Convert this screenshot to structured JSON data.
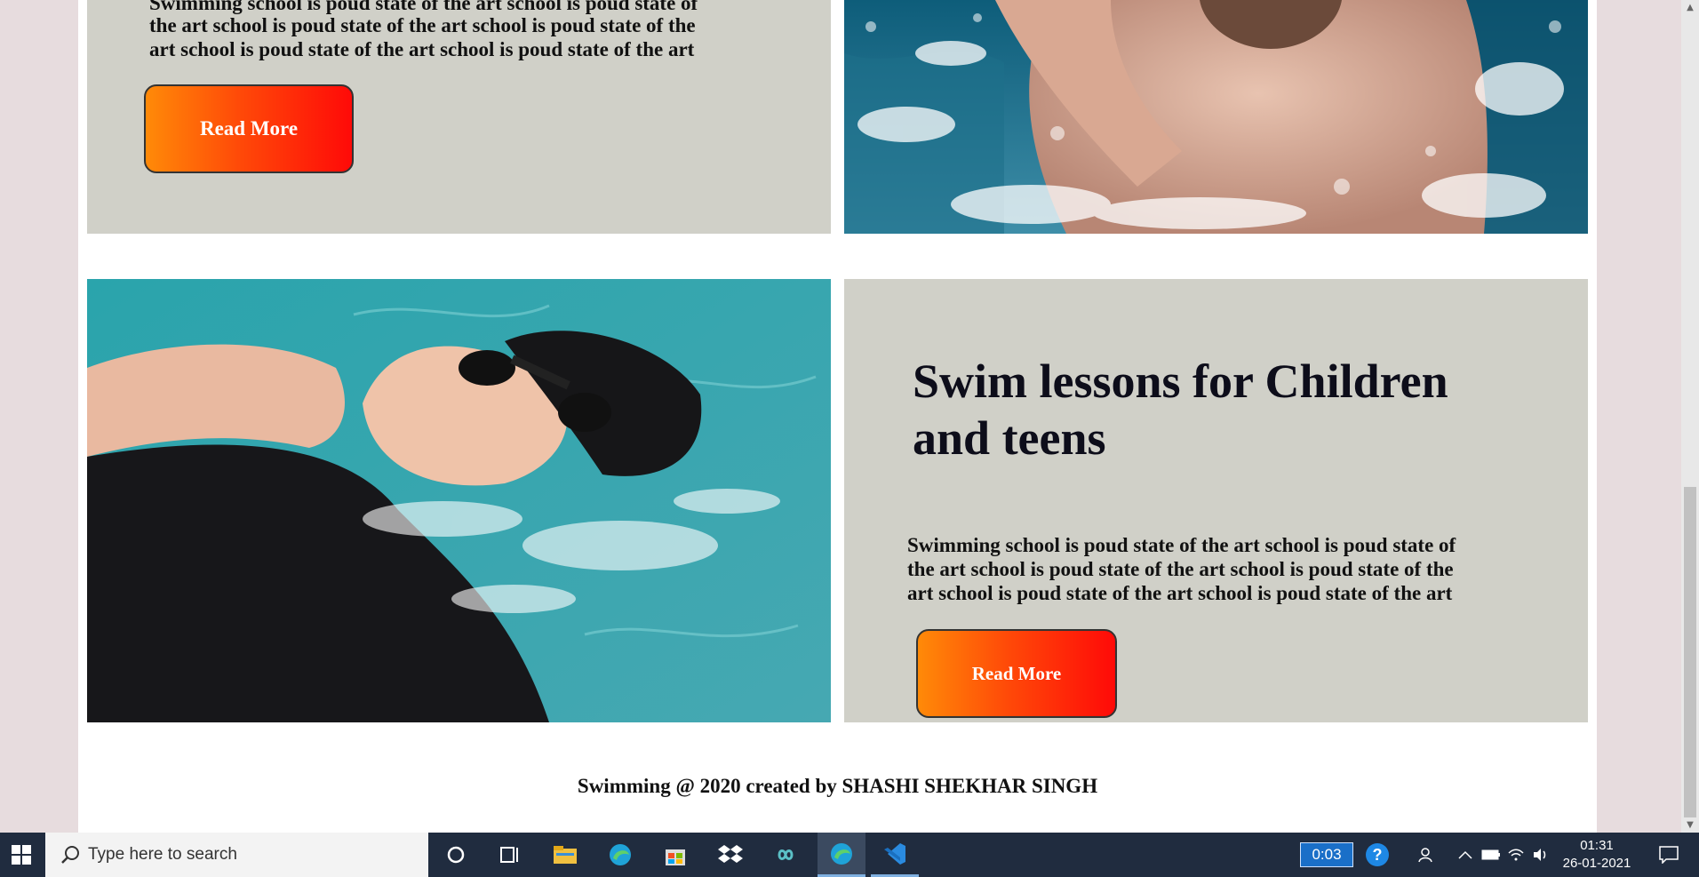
{
  "top_card": {
    "body_lines": [
      "Swimming school is poud state of the art school is poud state of",
      "the art school is poud state of the art school is poud state of the",
      "art school is poud state of the art school is poud state of the art"
    ],
    "button": "Read More"
  },
  "bottom_card": {
    "title_line1": "Swim lessons for Children",
    "title_line2": "and teens",
    "body_lines": [
      "Swimming school is poud state of the art school is poud state of",
      "the art school is poud state of the art school is poud state of the",
      "art school is poud state of the art school is poud state of the art"
    ],
    "button": "Read More"
  },
  "footer": {
    "text": "Swimming @ 2020 created by SHASHI SHEKHAR SINGH"
  },
  "taskbar": {
    "search_placeholder": "Type here to search",
    "timer": "0:03",
    "time": "01:31",
    "date": "26-01-2021",
    "icons": [
      "windows-start-icon",
      "search-icon",
      "cortana-icon",
      "task-view-icon",
      "file-explorer-icon",
      "edge-icon",
      "store-icon",
      "dropbox-icon",
      "infinity-icon",
      "edge-active-icon",
      "vscode-icon",
      "help-icon",
      "people-icon",
      "chevron-up-icon",
      "battery-icon",
      "wifi-icon",
      "volume-icon",
      "notification-icon"
    ]
  },
  "colors": {
    "page_bg": "#e7dcde",
    "panel_gray": "#d0d0c8",
    "button_start": "#ff8a08",
    "button_end": "#ff0a08",
    "taskbar": "#202c3f"
  }
}
